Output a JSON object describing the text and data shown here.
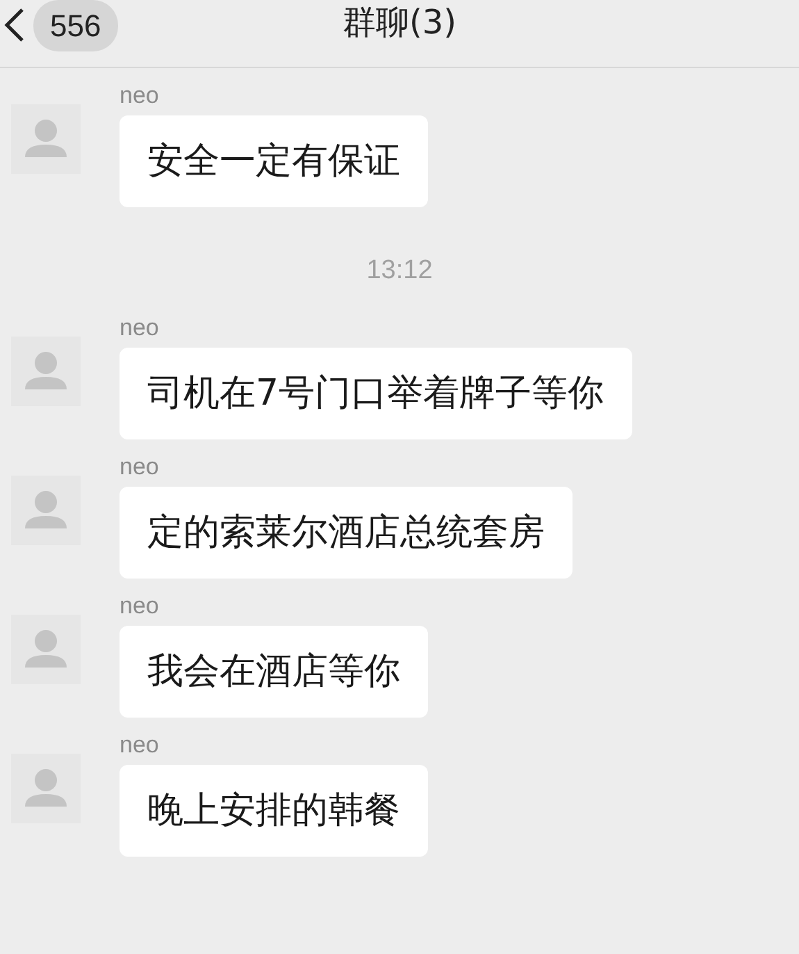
{
  "header": {
    "back_count": "556",
    "title": "群聊(3)"
  },
  "items": [
    {
      "kind": "message",
      "sender": "neo",
      "text": "安全一定有保证"
    },
    {
      "kind": "time",
      "text": "13:12"
    },
    {
      "kind": "message",
      "sender": "neo",
      "text": "司机在7号门口举着牌子等你"
    },
    {
      "kind": "message",
      "sender": "neo",
      "text": "定的索莱尔酒店总统套房"
    },
    {
      "kind": "message",
      "sender": "neo",
      "text": "我会在酒店等你"
    },
    {
      "kind": "message",
      "sender": "neo",
      "text": "晚上安排的韩餐"
    }
  ]
}
